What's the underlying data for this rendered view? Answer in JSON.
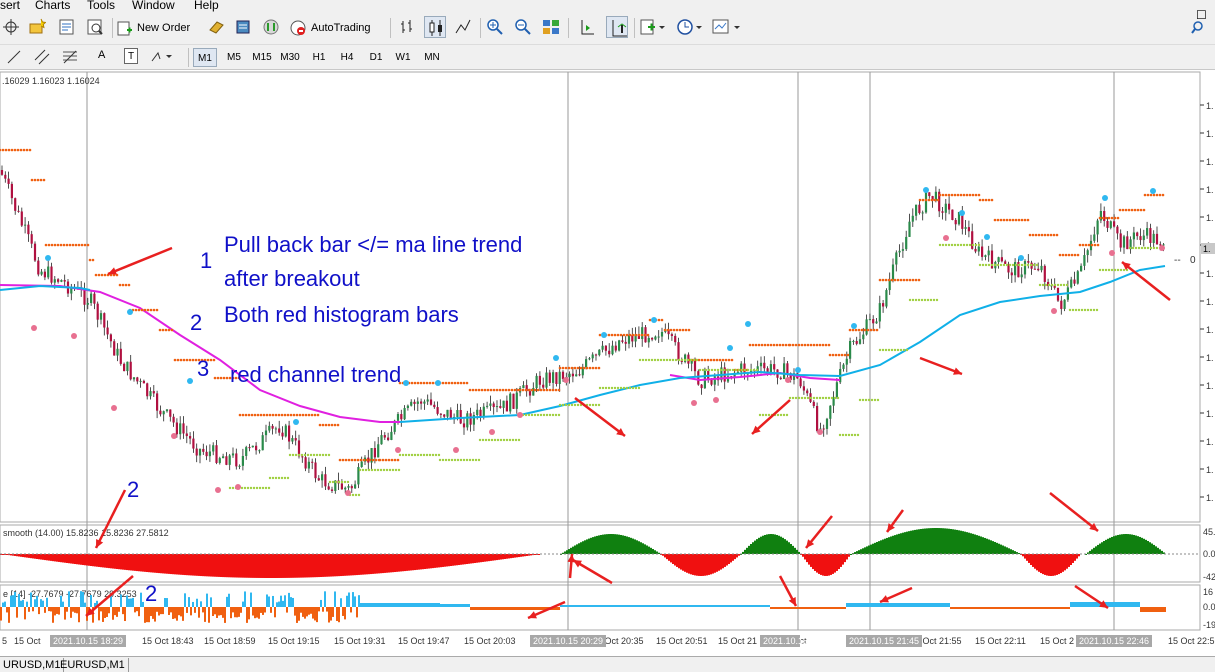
{
  "menu": [
    "sert",
    "Charts",
    "Tools",
    "Window",
    "Help"
  ],
  "toolbar": {
    "new_order": "New Order",
    "autotrading": "AutoTrading"
  },
  "timeframes": [
    "M1",
    "M5",
    "M15",
    "M30",
    "H1",
    "H4",
    "D1",
    "W1",
    "MN"
  ],
  "active_timeframe": "M1",
  "draw_tools": {
    "text": "A",
    "text_label": "T"
  },
  "chart": {
    "ohlc_text": ".16029 1.16023 1.16024",
    "price_label_tail": "0",
    "price_axis_labels": [
      "1.",
      "1.",
      "1.",
      "1.",
      "1.",
      "1.",
      "1.",
      "1.",
      "1.",
      "1.",
      "1.",
      "1.",
      "1.",
      "1.",
      "1."
    ],
    "current_price_label": "1.",
    "indicator1_label": "smooth (14.00) 15.8236 15.8236 27.5812",
    "indicator1_axis": [
      "45.",
      "0.0",
      "-42"
    ],
    "indicator2_label": "e [14] -27.7679 -27.7679 29.3253",
    "indicator2_axis": [
      "16",
      "0.0",
      "-19"
    ],
    "time_labels": [
      "5",
      "15 Oct 18:43",
      "15 Oct 18:59",
      "15 Oct 19:15",
      "15 Oct 19:31",
      "15 Oct 19:47",
      "15 Oct 20:03",
      "15 Oct 20:35",
      "15 Oct 20:51",
      "15 Oct 21",
      "15 Oct 21:55",
      "15 Oct 22:11",
      "15 Oct 2",
      "15 Oct 22:5"
    ],
    "time_labels_partial": [
      "15 Oct",
      "15 Oct"
    ],
    "highlighted_times": [
      "2021.10.15 18:29",
      "2021.10.15 20:29",
      "2021.10.15 21:2",
      "2021.10.15 21:45",
      "2021.10.15 22:46"
    ]
  },
  "annotations": {
    "n1": "1",
    "line1": "Pull back bar </= ma line trend",
    "line1b": "after breakout",
    "n2": "2",
    "line2": "Both red histogram bars",
    "n3": "3",
    "line3": "red channel trend",
    "n2b": "2",
    "n2c": "2"
  },
  "tabs": [
    "URUSD,M1",
    "EURUSD,M1"
  ],
  "colors": {
    "annotation": "#1010c8",
    "arrow": "#e82020",
    "ma_magenta": "#e020e0",
    "ma_cyan": "#10b0e8",
    "channel_orange": "#f06010",
    "channel_green": "#a0d040",
    "hist_green": "#108010",
    "hist_red": "#f01010",
    "hist_blue": "#30b8f0",
    "hist_orange": "#f06010"
  }
}
